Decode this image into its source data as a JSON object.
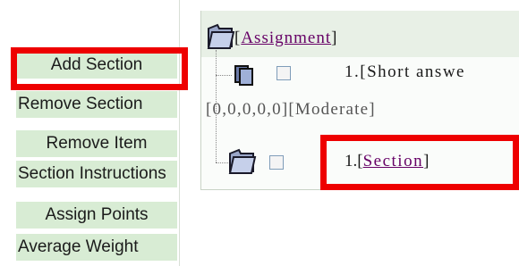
{
  "buttons": [
    {
      "label": "Add Section"
    },
    {
      "label": "Remove Section"
    },
    {
      "label": "Remove Item"
    },
    {
      "label": "Section Instructions"
    },
    {
      "label": "Assign Points"
    },
    {
      "label": "Average Weight"
    }
  ],
  "tree": {
    "root_label": "Assignment",
    "item": {
      "label": "1.[Short answe",
      "meta": "[0,0,0,0,0][Moderate]"
    },
    "section": {
      "number": "1.",
      "label": "Section"
    }
  },
  "colors": {
    "button_bg": "#d8ecd4",
    "link": "#660066",
    "highlight": "#ee0000"
  },
  "icons": {
    "root": "folder-icon",
    "item": "question-item-icon",
    "section": "folder-icon"
  }
}
